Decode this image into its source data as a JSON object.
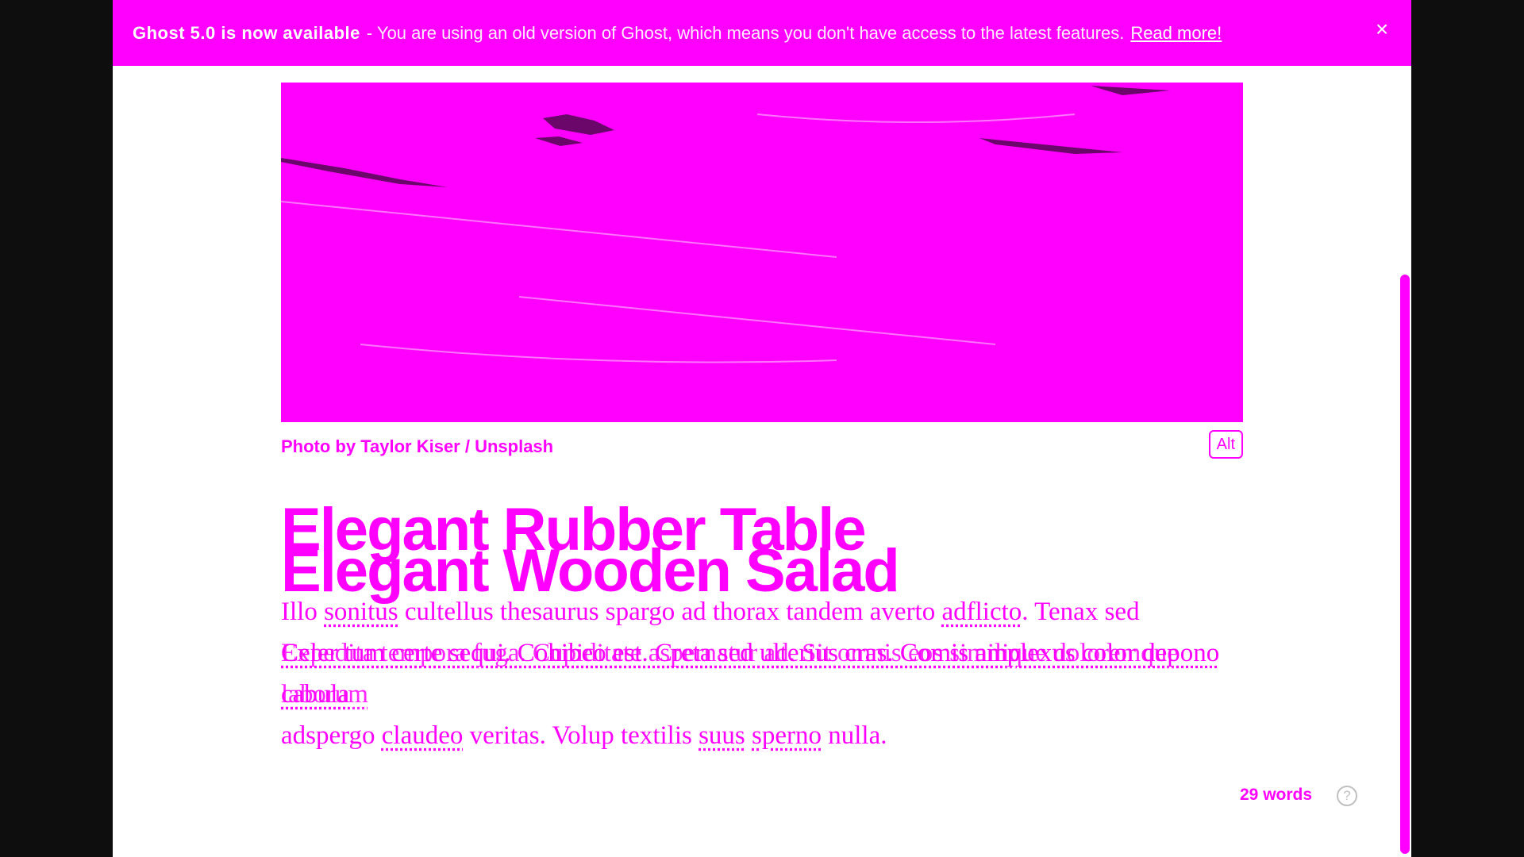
{
  "banner": {
    "title": "Ghost 5.0 is now available",
    "message": "- You are using an old version of Ghost, which means you don't have access to the latest features.",
    "link": "Read more!",
    "close": "×"
  },
  "feature_image": {
    "caption": "Photo by Taylor Kiser / Unsplash",
    "alt_button": "Alt"
  },
  "post": {
    "title_primary": "Elegant Rubber Table",
    "title_secondary": "Elegant Wooden Salad",
    "body_line1_a": "Illo ",
    "body_line1_u1": "sonitus",
    "body_line1_b": " cultellus thesaurus spargo ad thorax tandem averto ",
    "body_line1_u2": "adflicto",
    "body_line1_c": ". Tenax sed",
    "body_line2": "Celer tum certe sequi. Cohibeo est. Creta sed ulterius cras. Comis amplexus color depono cabula",
    "body_line3_a": "adspergo ",
    "body_line3_u1": "claudeo",
    "body_line3_b": " veritas. Volup textilis ",
    "body_line3_u2": "suus",
    "body_line3_c": " ",
    "body_line3_u3": "sperno",
    "body_line3_d": " nulla.",
    "ghost_line": "Expedita tempora fuga. Cupiditate aspernatur ad. Sit omnis eos similique doloremque laborum"
  },
  "footer": {
    "word_count": "29 words",
    "help": "?"
  },
  "colors": {
    "accent": "#ff00ff",
    "background": "#ffffff",
    "frame": "#0e0e0e"
  }
}
